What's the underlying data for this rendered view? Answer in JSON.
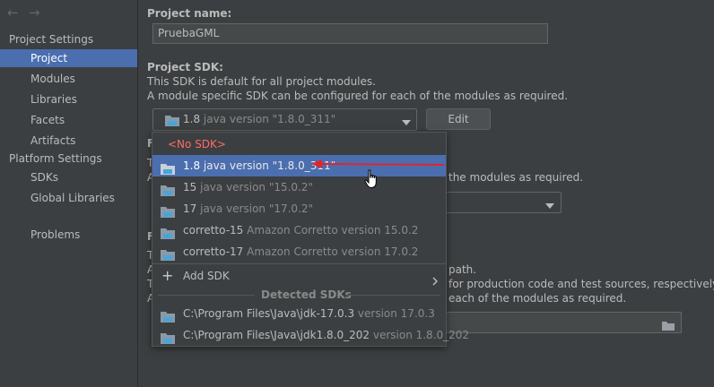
{
  "sidebar": {
    "nav_back": "←",
    "nav_forward": "→",
    "project_settings_header": "Project Settings",
    "platform_settings_header": "Platform Settings",
    "items": {
      "project": "Project",
      "modules": "Modules",
      "libraries": "Libraries",
      "facets": "Facets",
      "artifacts": "Artifacts",
      "sdks": "SDKs",
      "global_libraries": "Global Libraries",
      "problems": "Problems"
    }
  },
  "main": {
    "project_name_label": "Project name:",
    "project_name_value": "PruebaGML",
    "project_sdk_label": "Project SDK:",
    "sdk_desc_1": "This SDK is default for all project modules.",
    "sdk_desc_2": "A module specific SDK can be configured for each of the modules as required.",
    "sdk_selected_name": "1.8",
    "sdk_selected_version": "java version \"1.8.0_311\"",
    "edit_button": "Edit",
    "behind_f1": "F",
    "behind_t1": "T",
    "behind_a1": "A",
    "behind_modules_text": "the modules as required.",
    "behind_f2": "F",
    "behind_t2": "T",
    "behind_a2": "A",
    "behind_t3": "T",
    "behind_a3": "A",
    "behind_path": "path.",
    "behind_prod": "for production code and test sources, respectively.",
    "behind_each": "each of the modules as required."
  },
  "popup": {
    "no_sdk": "<No SDK>",
    "items": [
      {
        "name": "1.8",
        "version": "java version \"1.8.0_311\""
      },
      {
        "name": "15",
        "version": "java version \"15.0.2\""
      },
      {
        "name": "17",
        "version": "java version \"17.0.2\""
      },
      {
        "name": "corretto-15",
        "version": "Amazon Corretto version 15.0.2"
      },
      {
        "name": "corretto-17",
        "version": "Amazon Corretto version 17.0.2"
      }
    ],
    "add_sdk": "Add SDK",
    "detected_header": "Detected SDKs",
    "detected": [
      {
        "path": "C:\\Program Files\\Java\\jdk-17.0.3",
        "version": "version 17.0.3"
      },
      {
        "path": "C:\\Program Files\\Java\\jdk1.8.0_202",
        "version": "version 1.8.0_202"
      }
    ]
  },
  "colors": {
    "selection": "#4b6eaf",
    "no_sdk_red": "#ff6b68",
    "annotation_arrow": "#e0252b"
  },
  "icons": {
    "folder": "sdk-folder-icon",
    "dropdown": "chevron-down-icon",
    "submenu": "chevron-right-icon",
    "add": "plus-icon",
    "browse": "folder-browse-icon",
    "cursor": "hand-cursor-icon"
  }
}
